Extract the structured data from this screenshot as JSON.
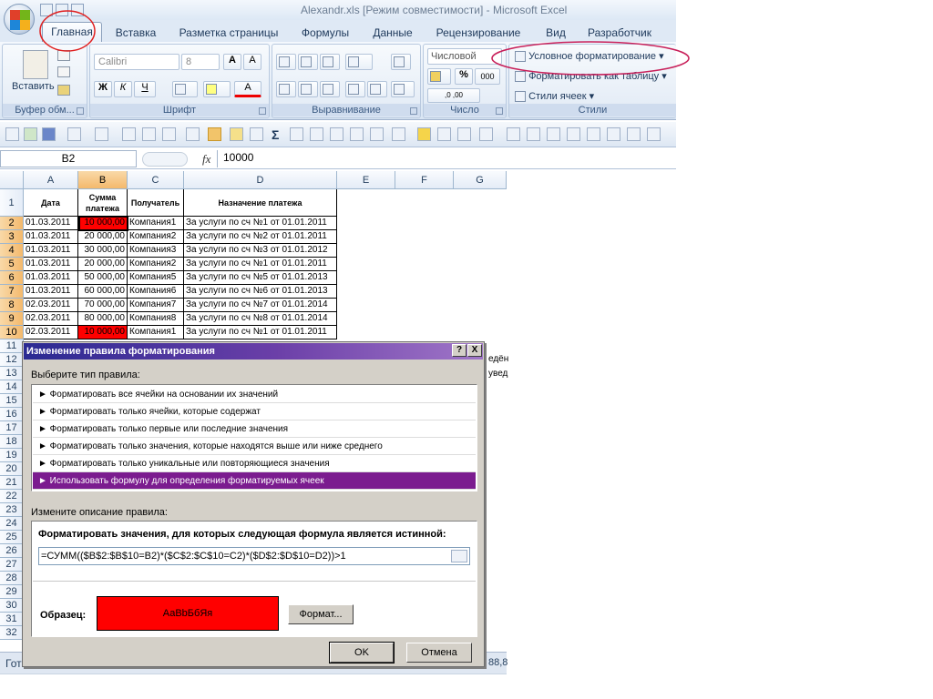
{
  "window": {
    "title": "Alexandr.xls  [Режим совместимости] - Microsoft Excel"
  },
  "tabs": [
    "Главная",
    "Вставка",
    "Разметка страницы",
    "Формулы",
    "Данные",
    "Рецензирование",
    "Вид",
    "Разработчик"
  ],
  "ribbon": {
    "clipboard": {
      "paste_label": "Вставить",
      "group_label": "Буфер обм..."
    },
    "font": {
      "name": "Calibri",
      "size": "8",
      "bold": "Ж",
      "italic": "К",
      "underline": "Ч",
      "fontcolor_glyph": "A",
      "grow": "A",
      "shrink": "A",
      "group_label": "Шрифт"
    },
    "alignment": {
      "group_label": "Выравнивание"
    },
    "number": {
      "format": "Числовой",
      "percent": "%",
      "thousands": "000",
      "inc_dec": ",0 ,00",
      "group_label": "Число"
    },
    "styles": {
      "conditional": "Условное форматирование",
      "as_table": "Форматировать как таблицу",
      "cell_styles": "Стили ячеек",
      "group_label": "Стили"
    }
  },
  "formula_bar": {
    "name_box": "B2",
    "fx": "fx",
    "value": "10000"
  },
  "columns": [
    "A",
    "B",
    "C",
    "D",
    "E",
    "F",
    "G"
  ],
  "rows": [
    "1",
    "2",
    "3",
    "4",
    "5",
    "6",
    "7",
    "8",
    "9",
    "10",
    "11",
    "12",
    "13",
    "14",
    "15",
    "16",
    "17",
    "18",
    "19",
    "20",
    "21",
    "22",
    "23",
    "24",
    "25",
    "26",
    "27",
    "28",
    "29",
    "30",
    "31",
    "32"
  ],
  "table": {
    "headers": {
      "date": "Дата",
      "sum": "Сумма платежа",
      "recipient": "Получатель",
      "purpose": "Назначение платежа"
    },
    "data": [
      [
        "01.03.2011",
        "10 000,00",
        "Компания1",
        "За услуги по сч №1 от 01.01.2011"
      ],
      [
        "01.03.2011",
        "20 000,00",
        "Компания2",
        "За услуги по сч №2 от 01.01.2011"
      ],
      [
        "01.03.2011",
        "30 000,00",
        "Компания3",
        "За услуги по сч №3 от 01.01.2012"
      ],
      [
        "01.03.2011",
        "20 000,00",
        "Компания2",
        "За услуги по сч №1 от 01.01.2011"
      ],
      [
        "01.03.2011",
        "50 000,00",
        "Компания5",
        "За услуги по сч №5 от 01.01.2013"
      ],
      [
        "01.03.2011",
        "60 000,00",
        "Компания6",
        "За услуги по сч №6 от 01.01.2013"
      ],
      [
        "02.03.2011",
        "70 000,00",
        "Компания7",
        "За услуги по сч №7 от 01.01.2014"
      ],
      [
        "02.03.2011",
        "80 000,00",
        "Компания8",
        "За услуги по сч №8 от 01.01.2014"
      ],
      [
        "02.03.2011",
        "10 000,00",
        "Компания1",
        "За услуги по сч №1 от 01.01.2011"
      ]
    ],
    "highlighted_rows": [
      0,
      8
    ],
    "highlight_color": "#ff0000"
  },
  "side_text": {
    "r12": "едён",
    "r13": "увед"
  },
  "dialog": {
    "title": "Изменение правила форматирования",
    "help": "?",
    "close": "X",
    "choose_type": "Выберите тип правила:",
    "rules": [
      "► Форматировать все ячейки на основании их значений",
      "► Форматировать только ячейки, которые содержат",
      "► Форматировать только первые или последние значения",
      "► Форматировать только значения, которые находятся выше или ниже среднего",
      "► Форматировать только уникальные или повторяющиеся значения",
      "► Использовать формулу для определения форматируемых ячеек"
    ],
    "selected_rule": 5,
    "edit_description": "Измените описание правила:",
    "formula_caption": "Форматировать значения, для которых следующая формула является истинной:",
    "formula": "=СУММ(($B$2:$B$10=B2)*($C$2:$C$10=C2)*($D$2:$D$10=D2))>1",
    "preview_label": "Образец:",
    "preview_text": "АаВbБбЯя",
    "preview_color": "#ff0000",
    "format_button": "Формат...",
    "ok": "OK",
    "cancel": "Отмена"
  },
  "status": {
    "left": "Гот",
    "right": "88,8"
  }
}
